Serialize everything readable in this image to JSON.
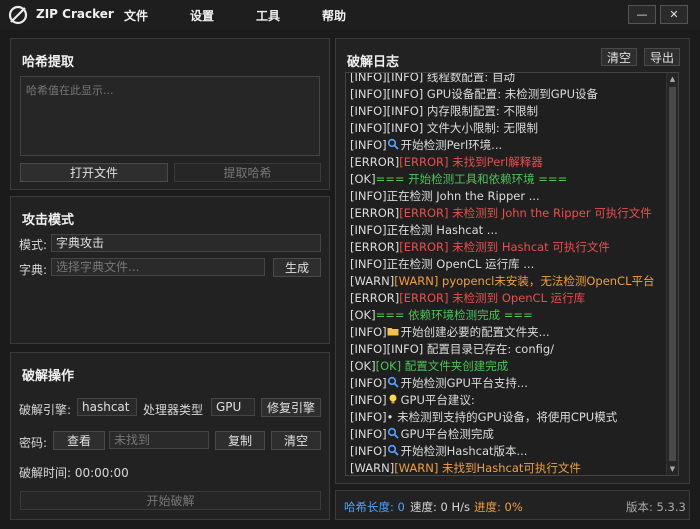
{
  "app": {
    "title": "ZIP Cracker",
    "menu": [
      "文件",
      "设置",
      "工具",
      "帮助"
    ],
    "window_buttons": {
      "minimize": "—",
      "close": "✕"
    }
  },
  "hash_panel": {
    "title": "哈希提取",
    "placeholder": "哈希值在此显示...",
    "open_button": "打开文件",
    "extract_button": "提取哈希"
  },
  "attack_panel": {
    "title": "攻击模式",
    "mode_label": "模式:",
    "mode_value": "字典攻击",
    "dict_label": "字典:",
    "dict_placeholder": "选择字典文件...",
    "generate_button": "生成"
  },
  "crack_panel": {
    "title": "破解操作",
    "engine_label": "破解引擎:",
    "engine_value": "hashcat",
    "processor_label": "处理器类型",
    "processor_value": "GPU",
    "fix_engine_button": "修复引擎",
    "password_label": "密码:",
    "view_button": "查看",
    "password_value": "未找到",
    "copy_button": "复制",
    "clear_button": "清空",
    "time_label": "破解时间: 00:00:00",
    "start_button": "开始破解"
  },
  "log_panel": {
    "title": "破解日志",
    "clear_button": "清空",
    "export_button": "导出",
    "lines": [
      {
        "prefix": "[INFO]",
        "text": "[INFO] 线程数配置: 自动",
        "cls": ""
      },
      {
        "prefix": "[INFO]",
        "text": "[INFO] GPU设备配置: 未检测到GPU设备",
        "cls": ""
      },
      {
        "prefix": "[INFO]",
        "text": "[INFO] 内存限制配置: 不限制",
        "cls": ""
      },
      {
        "prefix": "[INFO]",
        "text": "[INFO] 文件大小限制: 无限制",
        "cls": ""
      },
      {
        "prefix": "[INFO]",
        "icon": "search",
        "text": "开始检测Perl环境...",
        "cls": ""
      },
      {
        "prefix": "[ERROR]",
        "text": "[ERROR] 未找到Perl解释器",
        "cls": "c-err"
      },
      {
        "prefix": "[OK]",
        "text": "=== 开始检测工具和依赖环境 ===",
        "cls": "c-ok"
      },
      {
        "prefix": "[INFO]",
        "text": "正在检测 John the Ripper ...",
        "cls": ""
      },
      {
        "prefix": "[ERROR]",
        "text": "[ERROR] 未检测到 John the Ripper 可执行文件",
        "cls": "c-err"
      },
      {
        "prefix": "[INFO]",
        "text": "正在检测 Hashcat ...",
        "cls": ""
      },
      {
        "prefix": "[ERROR]",
        "text": "[ERROR] 未检测到 Hashcat 可执行文件",
        "cls": "c-err"
      },
      {
        "prefix": "[INFO]",
        "text": "正在检测 OpenCL 运行库 ...",
        "cls": ""
      },
      {
        "prefix": "[WARN]",
        "text": "[WARN] pyopencl未安装，无法检测OpenCL平台",
        "cls": "c-warn"
      },
      {
        "prefix": "[ERROR]",
        "text": "[ERROR] 未检测到 OpenCL 运行库",
        "cls": "c-err"
      },
      {
        "prefix": "[OK]",
        "text": "=== 依赖环境检测完成 ===",
        "cls": "c-ok"
      },
      {
        "prefix": "[INFO]",
        "icon": "folder",
        "text": "开始创建必要的配置文件夹...",
        "cls": ""
      },
      {
        "prefix": "[INFO]",
        "text": "[INFO] 配置目录已存在: config/",
        "cls": ""
      },
      {
        "prefix": "[OK]",
        "text": "[OK] 配置文件夹创建完成",
        "cls": "c-ok"
      },
      {
        "prefix": "[INFO]",
        "icon": "search",
        "text": "开始检测GPU平台支持...",
        "cls": ""
      },
      {
        "prefix": "[INFO]",
        "icon": "bulb",
        "text": "GPU平台建议:",
        "cls": ""
      },
      {
        "prefix": "[INFO]",
        "text": "• 未检测到支持的GPU设备，将使用CPU模式",
        "cls": ""
      },
      {
        "prefix": "[INFO]",
        "icon": "search",
        "text": "GPU平台检测完成",
        "cls": ""
      },
      {
        "prefix": "[INFO]",
        "icon": "search",
        "text": "开始检测Hashcat版本...",
        "cls": ""
      },
      {
        "prefix": "[WARN]",
        "text": "[WARN] 未找到Hashcat可执行文件",
        "cls": "c-warn"
      }
    ]
  },
  "status": {
    "hash_length": "哈希长度: 0",
    "speed": "速度: 0 H/s",
    "progress": "进度: 0%",
    "version": "版本: 5.3.3"
  },
  "colors": {
    "error": "#e84f4f",
    "ok": "#4cc35a",
    "warn": "#f0a040",
    "accent": "#4aa3ff"
  }
}
